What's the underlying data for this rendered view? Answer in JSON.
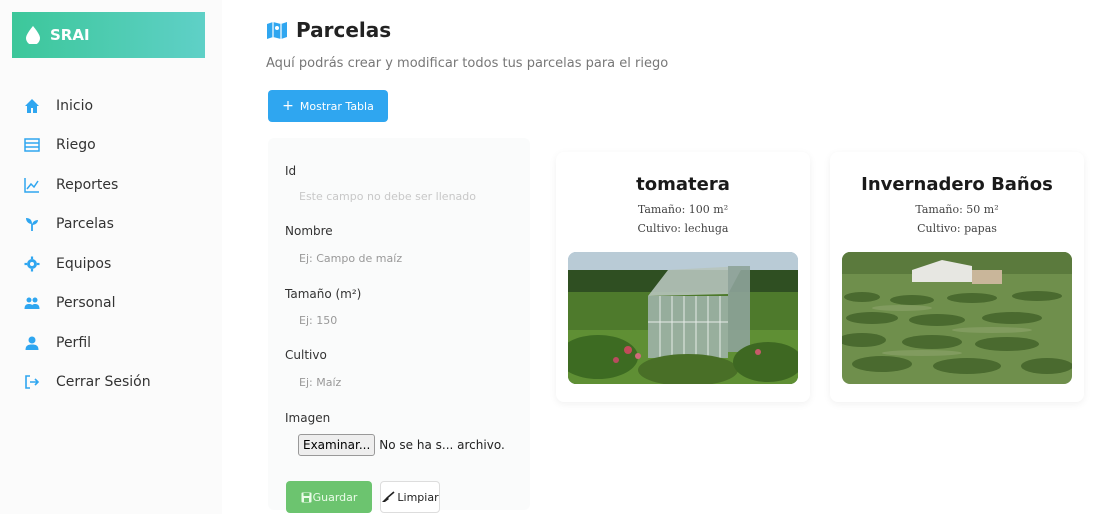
{
  "brand": {
    "name": "SRAI",
    "colors": {
      "gradient_start": "#3cc79a",
      "gradient_end": "#5fd0c7"
    }
  },
  "sidebar": {
    "items": [
      {
        "label": "Inicio",
        "icon": "home-icon",
        "color": "#2fa6f0"
      },
      {
        "label": "Riego",
        "icon": "table-icon",
        "color": "#2fa6f0"
      },
      {
        "label": "Reportes",
        "icon": "chart-line-icon",
        "color": "#2fa6f0"
      },
      {
        "label": "Parcelas",
        "icon": "seedling-icon",
        "color": "#2fa6f0"
      },
      {
        "label": "Equipos",
        "icon": "gear-icon",
        "color": "#2fa6f0"
      },
      {
        "label": "Personal",
        "icon": "users-icon",
        "color": "#2fa6f0"
      },
      {
        "label": "Perfil",
        "icon": "user-icon",
        "color": "#2fa6f0"
      },
      {
        "label": "Cerrar Sesión",
        "icon": "sign-out-icon",
        "color": "#2fa6f0"
      }
    ]
  },
  "header": {
    "title": "Parcelas",
    "title_icon": "map-icon",
    "subtitle": "Aquí podrás crear y modificar todos tus parcelas para el riego"
  },
  "toggle_button": {
    "label": "Mostrar Tabla",
    "color": "#2fa6f0"
  },
  "form": {
    "id_label": "Id",
    "id_placeholder": "Este campo no debe ser llenado",
    "nombre_label": "Nombre",
    "nombre_placeholder": "Ej: Campo de maíz",
    "tamano_label": "Tamaño (m²)",
    "tamano_placeholder": "Ej: 150",
    "cultivo_label": "Cultivo",
    "cultivo_placeholder": "Ej: Maíz",
    "imagen_label": "Imagen",
    "file_button": "Examinar...",
    "file_status": "No se ha s... archivo.",
    "save_label": "Guardar",
    "save_color": "#6cc46f",
    "clear_label": "Limpiar"
  },
  "parcels": [
    {
      "name": "tomatera",
      "size": "Tamaño: 100 m²",
      "crop": "Cultivo: lechuga",
      "image": "greenhouse-garden"
    },
    {
      "name": "Invernadero Baños",
      "size": "Tamaño: 50 m²",
      "crop": "Cultivo: papas",
      "image": "olive-field"
    }
  ]
}
